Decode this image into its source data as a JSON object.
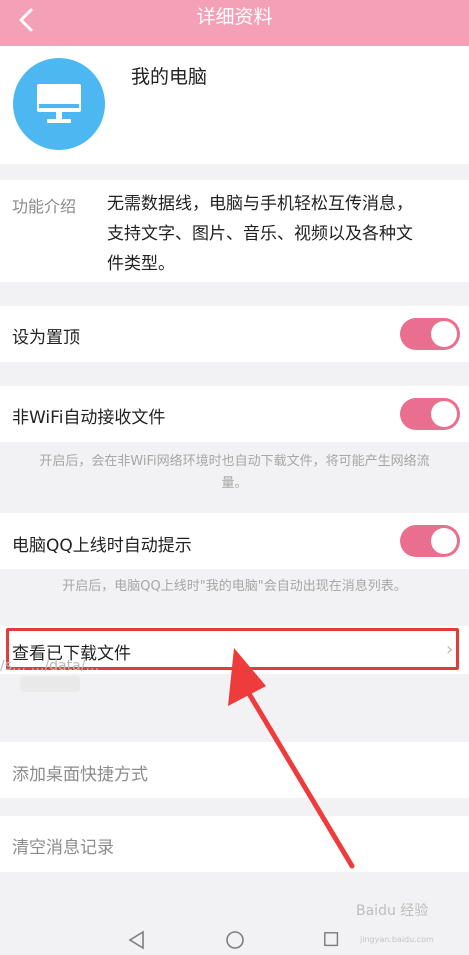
{
  "header": {
    "title": "详细资料"
  },
  "profile": {
    "name": "我的电脑"
  },
  "intro": {
    "label": "功能介绍",
    "lines": [
      "无需数据线，电脑与手机轻松互传消息，",
      "支持文字、图片、音乐、视频以及各种文",
      "件类型。"
    ]
  },
  "settings": {
    "pin": {
      "label": "设为置顶",
      "on": true
    },
    "wifi": {
      "label": "非WiFi自动接收文件",
      "on": true,
      "hint_lines": [
        "开启后，会在非WiFi网络环境时也自动下载文件，将可能产生网络流",
        "量。"
      ]
    },
    "pc_online": {
      "label": "电脑QQ上线时自动提示",
      "on": true,
      "hint": "开启后，电脑QQ上线时\"我的电脑\"会自动出现在消息列表。"
    }
  },
  "downloads": {
    "label": "查看已下载文件",
    "path_text": "/s… …/data/…"
  },
  "actions": {
    "shortcut": "添加桌面快捷方式",
    "clear": "清空消息记录"
  },
  "watermark": {
    "brand": "Baidu 经验",
    "url": "jingyan.baidu.com"
  },
  "colors": {
    "header": "#f4a1b8",
    "toggle": "#ea6f8e",
    "avatar": "#4db7f2",
    "highlight": "#e03c3c"
  }
}
